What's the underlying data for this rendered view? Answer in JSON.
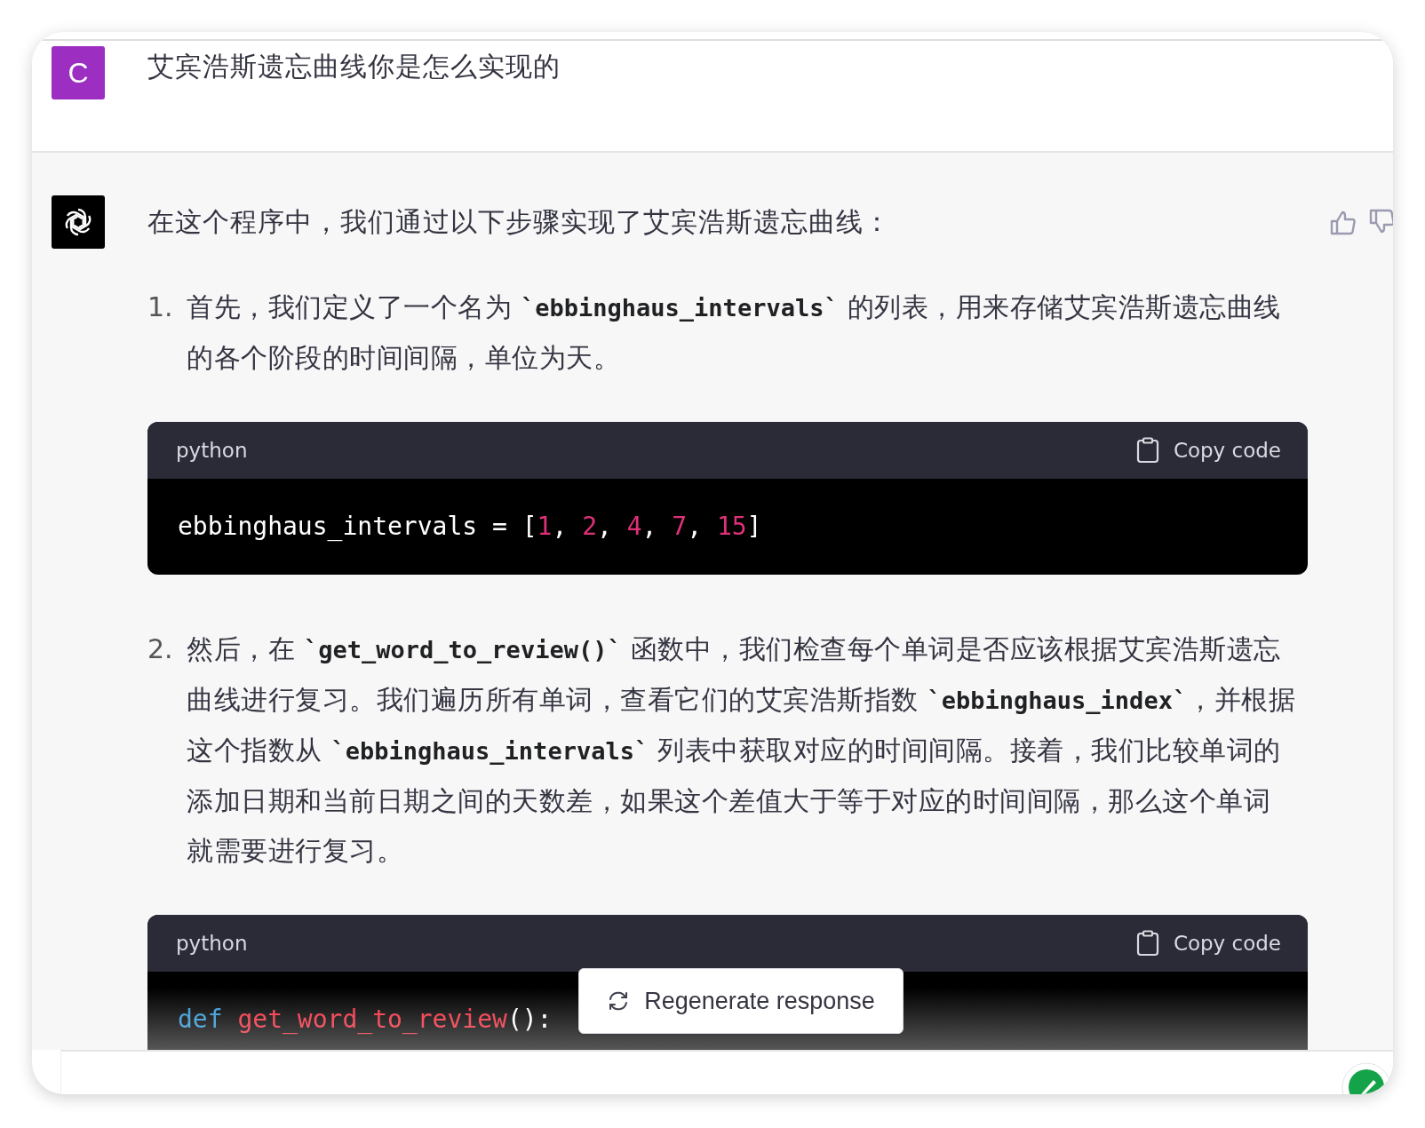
{
  "user_message": {
    "avatar": "C",
    "text": "艾宾浩斯遗忘曲线你是怎么实现的"
  },
  "assistant_message": {
    "intro": "在这个程序中，我们通过以下步骤实现了艾宾浩斯遗忘曲线：",
    "steps": [
      {
        "number": "1.",
        "segments": [
          {
            "kind": "text",
            "text": "首先，我们定义了一个名为 "
          },
          {
            "kind": "code",
            "text": "`ebbinghaus_intervals`"
          },
          {
            "kind": "text",
            "text": " 的列表，用来存储艾宾浩斯遗忘曲线的各个阶段的时间间隔，单位为天。"
          }
        ],
        "code_block": {
          "language": "python",
          "copy_label": "Copy code",
          "lines": [
            [
              {
                "kind": "plain",
                "text": "ebbinghaus_intervals = ["
              },
              {
                "kind": "number",
                "text": "1"
              },
              {
                "kind": "plain",
                "text": ", "
              },
              {
                "kind": "number",
                "text": "2"
              },
              {
                "kind": "plain",
                "text": ", "
              },
              {
                "kind": "number",
                "text": "4"
              },
              {
                "kind": "plain",
                "text": ", "
              },
              {
                "kind": "number",
                "text": "7"
              },
              {
                "kind": "plain",
                "text": ", "
              },
              {
                "kind": "number",
                "text": "15"
              },
              {
                "kind": "plain",
                "text": "]"
              }
            ]
          ]
        }
      },
      {
        "number": "2.",
        "segments": [
          {
            "kind": "text",
            "text": "然后，在 "
          },
          {
            "kind": "code",
            "text": "`get_word_to_review()`"
          },
          {
            "kind": "text",
            "text": " 函数中，我们检查每个单词是否应该根据艾宾浩斯遗忘曲线进行复习。我们遍历所有单词，查看它们的艾宾浩斯指数 "
          },
          {
            "kind": "code",
            "text": "`ebbinghaus_index`"
          },
          {
            "kind": "text",
            "text": "，并根据这个指数从 "
          },
          {
            "kind": "code",
            "text": "`ebbinghaus_intervals`"
          },
          {
            "kind": "text",
            "text": " 列表中获取对应的时间间隔。接着，我们比较单词的添加日期和当前日期之间的天数差，如果这个差值大于等于对应的时间间隔，那么这个单词就需要进行复习。"
          }
        ],
        "code_block": {
          "language": "python",
          "copy_label": "Copy code",
          "lines": [
            [
              {
                "kind": "keyword",
                "text": "def "
              },
              {
                "kind": "function",
                "text": "get_word_to_review"
              },
              {
                "kind": "plain",
                "text": "():"
              }
            ]
          ]
        }
      }
    ]
  },
  "regenerate_button": {
    "label": "Regenerate response"
  }
}
